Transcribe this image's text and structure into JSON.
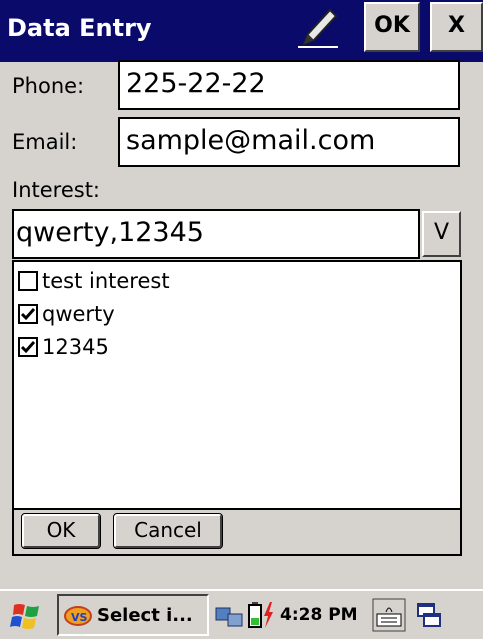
{
  "window": {
    "title": "Data Entry",
    "ok_label": "OK",
    "close_label": "X"
  },
  "form": {
    "phone_label": "Phone:",
    "phone_value": "225-22-22",
    "email_label": "Email:",
    "email_value": "sample@mail.com",
    "interest_label": "Interest:",
    "interest_value": "qwerty,12345",
    "dropdown_label": "V"
  },
  "list": {
    "items": [
      {
        "label": "test interest",
        "checked": false
      },
      {
        "label": "qwerty",
        "checked": true
      },
      {
        "label": "12345",
        "checked": true
      }
    ],
    "ok_label": "OK",
    "cancel_label": "Cancel"
  },
  "taskbar": {
    "task_label": "Select i...",
    "clock": "4:28 PM"
  },
  "colors": {
    "titlebar": "#0a0a6a",
    "chrome": "#d6d3ce"
  }
}
